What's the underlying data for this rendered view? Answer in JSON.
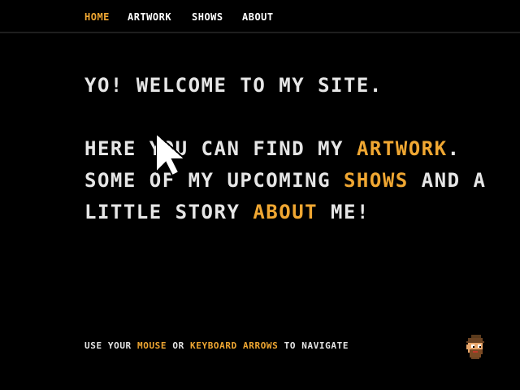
{
  "nav": {
    "items": [
      {
        "label": "HOME",
        "active": true
      },
      {
        "label": "ARTWORK",
        "active": false
      },
      {
        "label": "SHOWS",
        "active": false
      },
      {
        "label": "ABOUT",
        "active": false
      }
    ]
  },
  "main": {
    "greeting": "YO! WELCOME TO MY SITE.",
    "intro_1": "HERE YOU CAN FIND MY ",
    "artwork_link": "ARTWORK",
    "intro_2": ". SOME OF MY UPCOMING ",
    "shows_link": "SHOWS",
    "intro_3": " AND A LITTLE STORY ",
    "about_link": "ABOUT",
    "intro_4": " ME!"
  },
  "footer": {
    "hint_1": "USE YOUR ",
    "hint_mouse": "MOUSE",
    "hint_2": " OR ",
    "hint_keyboard": "KEYBOARD ARROWS",
    "hint_3": " TO NAVIGATE"
  },
  "colors": {
    "background": "#000000",
    "text": "#e6e6e6",
    "accent": "#f0a732"
  },
  "icons": {
    "avatar": "pixel-character-face-icon",
    "cursor": "mouse-pointer-icon"
  }
}
